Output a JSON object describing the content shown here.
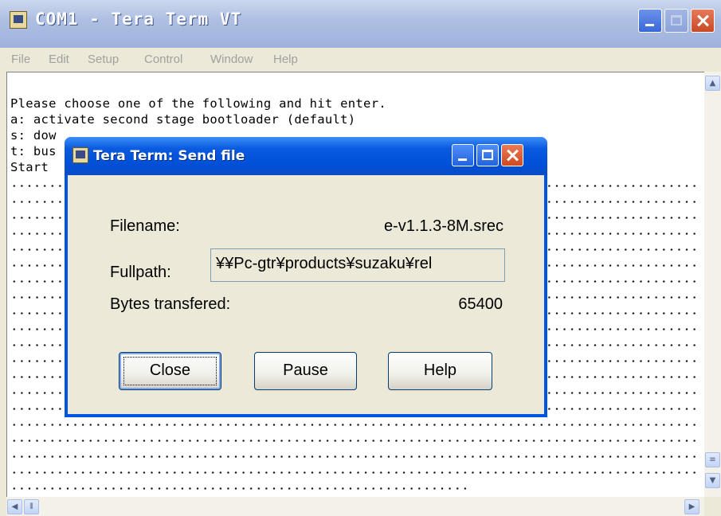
{
  "window": {
    "title": "COM1 - Tera Term VT"
  },
  "menu": [
    "File",
    "Edit",
    "Setup",
    "Control",
    "Window",
    "Help"
  ],
  "terminal": {
    "lines": [
      "Please choose one of the following and hit enter.",
      "a: activate second stage bootloader (default)",
      "s: dow",
      "t: bus",
      "Start "
    ]
  },
  "dialog": {
    "title": "Tera Term: Send file",
    "filename_label": "Filename:",
    "filename_value": "e-v1.1.3-8M.srec",
    "fullpath_label": "Fullpath:",
    "fullpath_value": "¥¥Pc-gtr¥products¥suzaku¥rel",
    "bytes_label": "Bytes transfered:",
    "bytes_value": "65400",
    "close_label": "Close",
    "pause_label": "Pause",
    "help_label": "Help"
  }
}
